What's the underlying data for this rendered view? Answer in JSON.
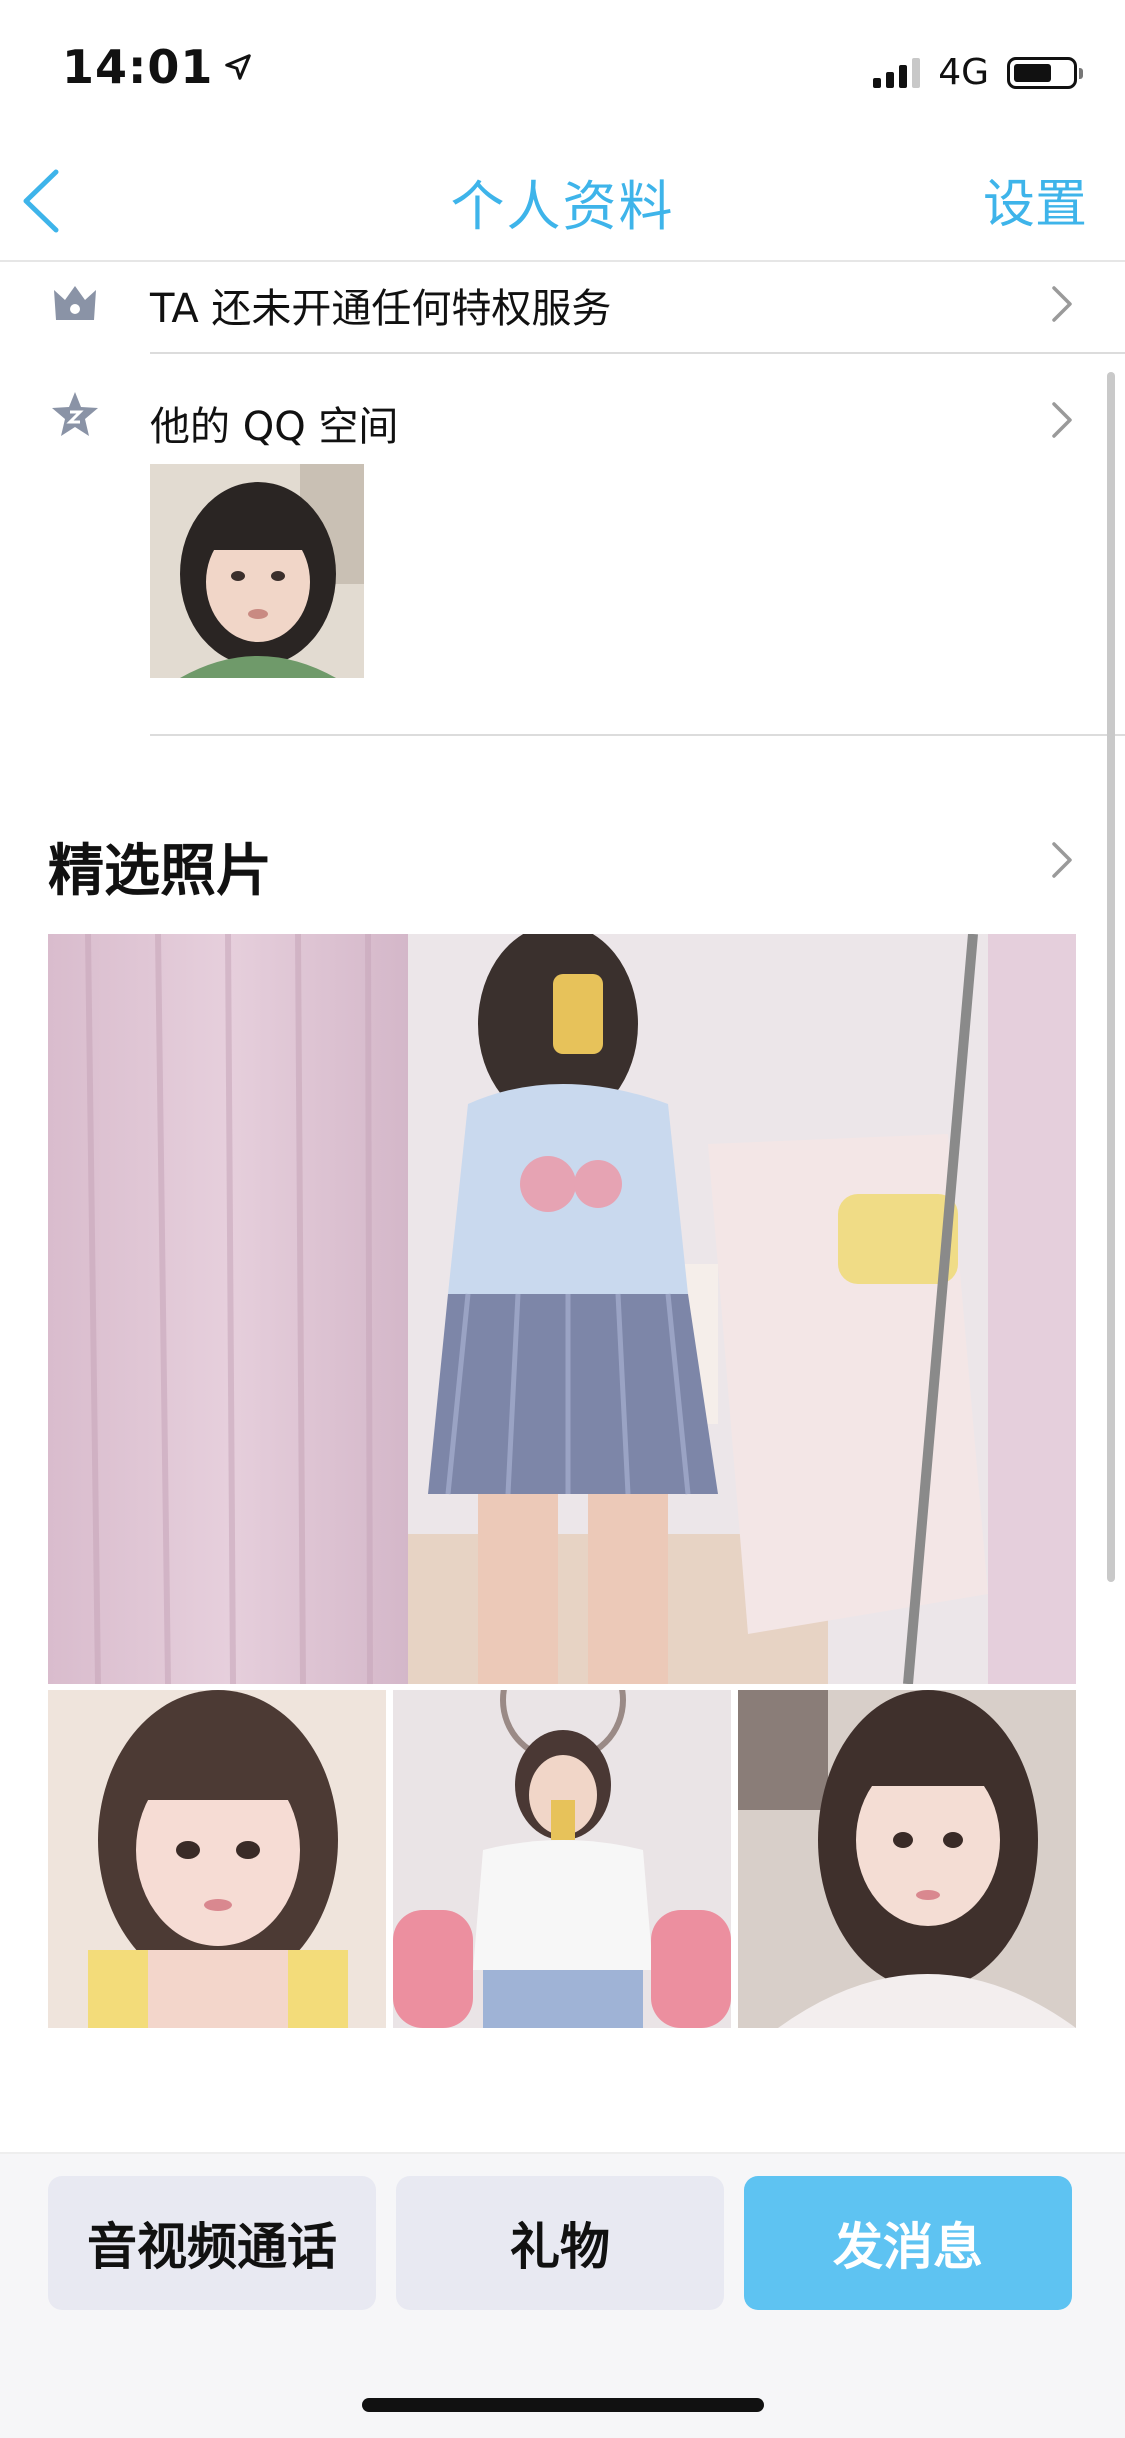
{
  "status_bar": {
    "time": "14:01",
    "network": "4G"
  },
  "nav": {
    "title": "个人资料",
    "settings_label": "设置"
  },
  "rows": {
    "privilege_label": "TA 还未开通任何特权服务",
    "qzone_label": "他的 QQ 空间"
  },
  "featured": {
    "title": "精选照片"
  },
  "actions": {
    "call_label": "音视频通话",
    "gift_label": "礼物",
    "message_label": "发消息"
  },
  "colors": {
    "accent": "#3eb4ea",
    "primary_button": "#5ec3f2",
    "secondary_button": "#e8e9f2"
  },
  "icons": {
    "back": "chevron-left-icon",
    "location": "location-arrow-icon",
    "privilege": "crown-icon",
    "qzone": "star-icon",
    "row_arrow": "chevron-right-icon"
  }
}
